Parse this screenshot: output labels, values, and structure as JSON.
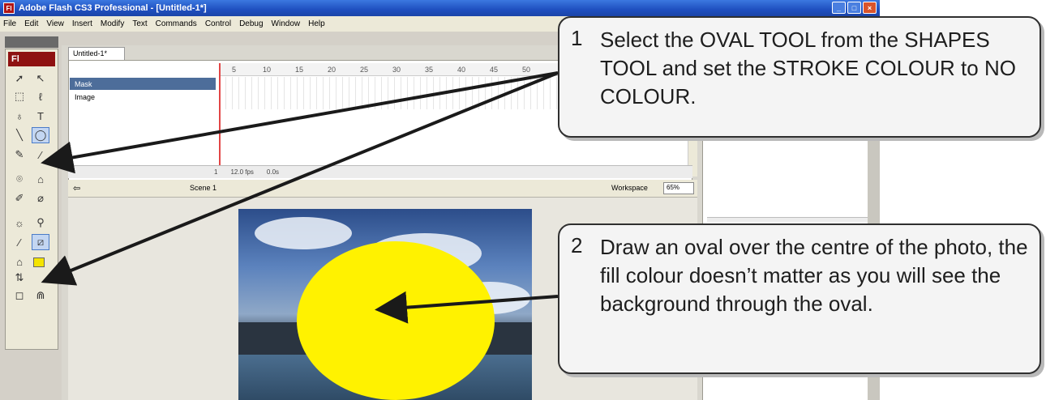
{
  "window": {
    "title": "Adobe Flash CS3 Professional - [Untitled-1*]",
    "app_icon": "Fl"
  },
  "menu": [
    "File",
    "Edit",
    "View",
    "Insert",
    "Modify",
    "Text",
    "Commands",
    "Control",
    "Debug",
    "Window",
    "Help"
  ],
  "tools": {
    "logo": "Fl",
    "fill_color": "#f4e400",
    "stroke_color": "none"
  },
  "document": {
    "tab_label": "Untitled-1*",
    "frame_numbers": [
      "5",
      "10",
      "15",
      "20",
      "25",
      "30",
      "35",
      "40",
      "45",
      "50"
    ],
    "layers": [
      {
        "name": "Mask",
        "active": true
      },
      {
        "name": "Image",
        "active": false
      }
    ],
    "fps": "12.0 fps",
    "time": "0.0s",
    "frame": "1",
    "scene": "Scene 1",
    "workspace": "Workspace",
    "zoom": "65%"
  },
  "stage": {
    "oval_color": "#fff200"
  },
  "callouts": [
    {
      "number": "1",
      "text": "Select the OVAL TOOL from the SHAPES TOOL and set the STROKE COLOUR to NO COLOUR."
    },
    {
      "number": "2",
      "text": "Draw an oval over the centre of the photo, the fill colour doesn’t matter as you will see the background through the oval."
    }
  ]
}
